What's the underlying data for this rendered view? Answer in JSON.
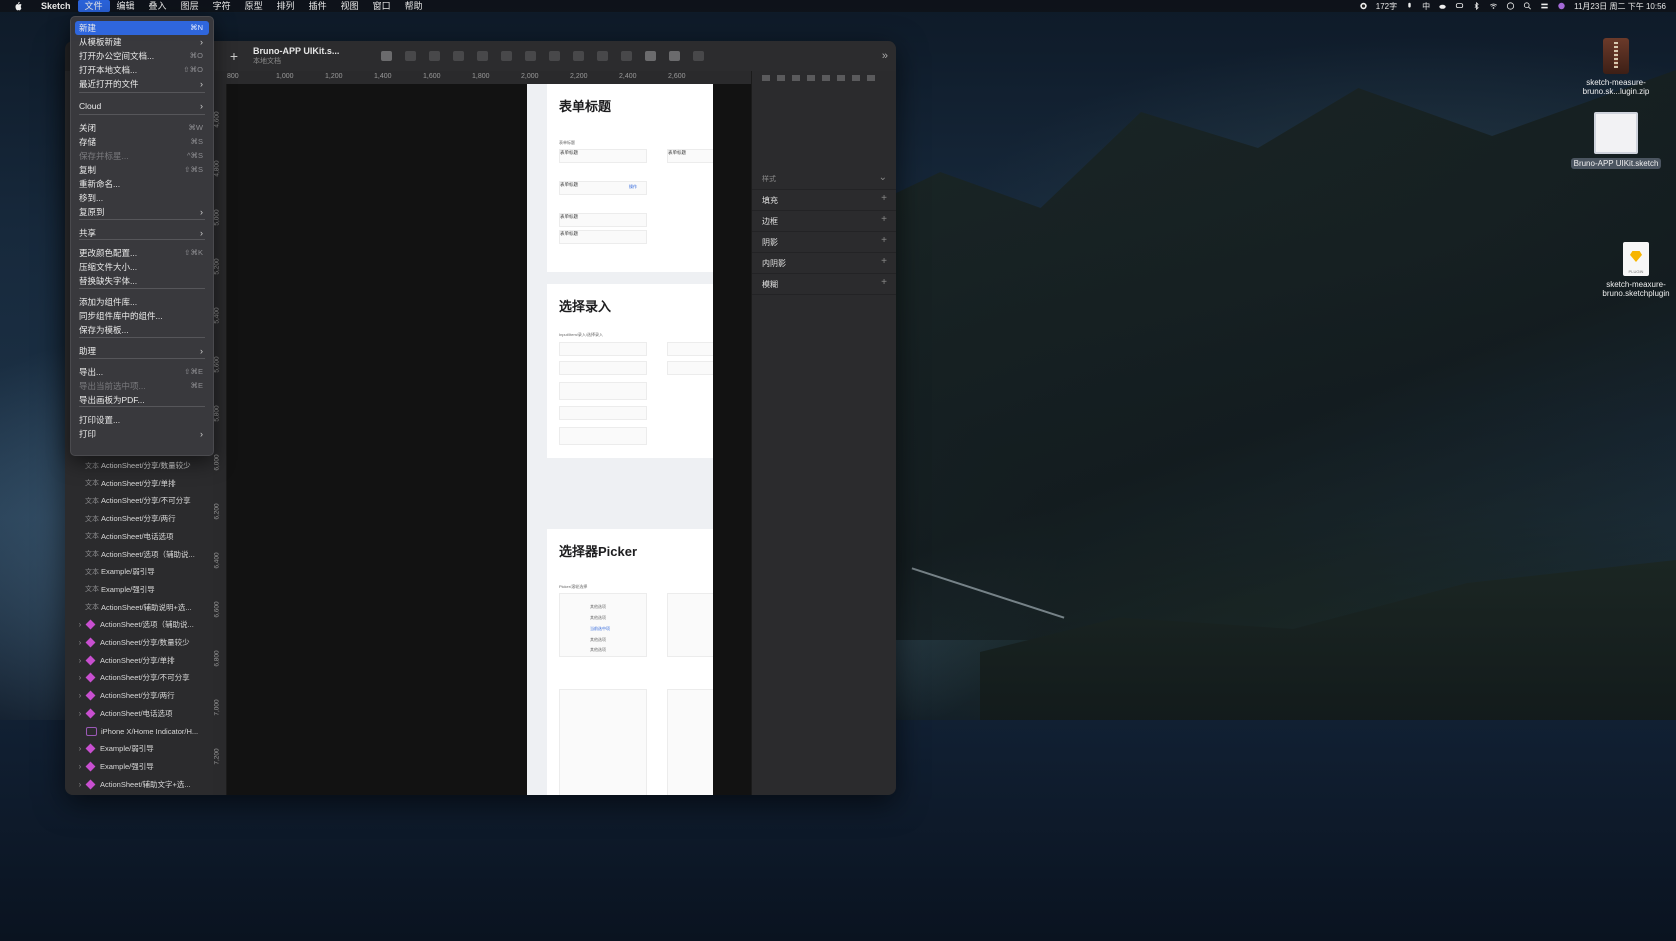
{
  "menubar": {
    "app_name": "Sketch",
    "menus": [
      "文件",
      "编辑",
      "叠入",
      "图层",
      "字符",
      "原型",
      "排列",
      "插件",
      "视图",
      "窗口",
      "帮助"
    ],
    "status_text": "172字",
    "input_method": "中",
    "datetime": "11月23日 周二 下午 10:56"
  },
  "window": {
    "doc_title": "Bruno-APP UIKit.s...",
    "doc_subtitle": "本地文档"
  },
  "ruler": {
    "h_ticks": [
      "800",
      "1,000",
      "1,200",
      "1,400",
      "1,600",
      "1,800",
      "2,000",
      "2,200",
      "2,400",
      "2,600"
    ],
    "v_ticks": [
      "4,600",
      "4,800",
      "5,000",
      "5,200",
      "5,400",
      "5,600",
      "5,800",
      "6,000",
      "6,200",
      "6,400",
      "6,600",
      "6,800",
      "7,000",
      "7,200"
    ]
  },
  "file_menu": {
    "items": [
      {
        "label": "新建",
        "shortcut": "⌘N",
        "selected": true
      },
      {
        "label": "从模板新建",
        "submenu": true
      },
      {
        "label": "打开办公空间文档...",
        "shortcut": "⌘O"
      },
      {
        "label": "打开本地文档...",
        "shortcut": "⇧⌘O"
      },
      {
        "label": "最近打开的文件",
        "submenu": true
      },
      {
        "label": "Cloud",
        "submenu": true
      },
      {
        "label": "关闭",
        "shortcut": "⌘W"
      },
      {
        "label": "存储",
        "shortcut": "⌘S"
      },
      {
        "label": "保存并标星...",
        "shortcut": "^⌘S",
        "disabled": true
      },
      {
        "label": "复制",
        "shortcut": "⇧⌘S"
      },
      {
        "label": "重新命名..."
      },
      {
        "label": "移到..."
      },
      {
        "label": "复原到",
        "submenu": true
      },
      {
        "label": "共享",
        "submenu": true
      },
      {
        "label": "更改颜色配置...",
        "shortcut": "⇧⌘K"
      },
      {
        "label": "压缩文件大小..."
      },
      {
        "label": "替换缺失字体..."
      },
      {
        "label": "添加为组件库..."
      },
      {
        "label": "同步组件库中的组件..."
      },
      {
        "label": "保存为模板..."
      },
      {
        "label": "助理",
        "submenu": true
      },
      {
        "label": "导出...",
        "shortcut": "⇧⌘E"
      },
      {
        "label": "导出当前选中项...",
        "shortcut": "⌘E",
        "disabled": true
      },
      {
        "label": "导出画板为PDF..."
      },
      {
        "label": "打印设置..."
      },
      {
        "label": "打印",
        "submenu": true
      }
    ]
  },
  "layers": [
    {
      "tag": "文本",
      "label": "ActionSheet/分享/数量较少"
    },
    {
      "tag": "文本",
      "label": "ActionSheet/分享/单排"
    },
    {
      "tag": "文本",
      "label": "ActionSheet/分享/不可分享"
    },
    {
      "tag": "文本",
      "label": "ActionSheet/分享/两行"
    },
    {
      "tag": "文本",
      "label": "ActionSheet/电话选项"
    },
    {
      "tag": "文本",
      "label": "ActionSheet/选项（辅助说..."
    },
    {
      "tag": "文本",
      "label": "Example/弱引导"
    },
    {
      "tag": "文本",
      "label": "Example/强引导"
    },
    {
      "tag": "文本",
      "label": "ActionSheet/辅助说明+选..."
    },
    {
      "tag": "sym",
      "label": "ActionSheet/选项（辅助说..."
    },
    {
      "tag": "sym",
      "label": "ActionSheet/分享/数量较少"
    },
    {
      "tag": "sym",
      "label": "ActionSheet/分享/单排"
    },
    {
      "tag": "sym",
      "label": "ActionSheet/分享/不可分享"
    },
    {
      "tag": "sym",
      "label": "ActionSheet/分享/两行"
    },
    {
      "tag": "sym",
      "label": "ActionSheet/电话选项"
    },
    {
      "tag": "ref",
      "label": "iPhone X/Home Indicator/H..."
    },
    {
      "tag": "sym",
      "label": "Example/弱引导"
    },
    {
      "tag": "sym",
      "label": "Example/强引导"
    },
    {
      "tag": "sym",
      "label": "ActionSheet/辅助文字+选..."
    }
  ],
  "artboard": {
    "sections": [
      "表单标题",
      "选择录入",
      "选择器Picker"
    ],
    "form_field": "表单标题",
    "form_action": "操作",
    "select_caption": "Input/Item/录入/选择录入",
    "picker_caption": "Picker/滚轮选择",
    "picker_items": [
      "其他选项",
      "其他选项",
      "当前选中项",
      "其他选项",
      "其他选项"
    ]
  },
  "inspector": {
    "style_label": "样式",
    "rows": [
      "填充",
      "边框",
      "阴影",
      "内阴影",
      "模糊"
    ]
  },
  "desktop_icons": [
    {
      "label": "sketch-measure-bruno.sk...lugin.zip"
    },
    {
      "label": "Bruno-APP UIKit.sketch"
    },
    {
      "label": "sketch-meaxure-bruno.sketchplugin"
    }
  ],
  "colors": {
    "accent": "#2f66dc",
    "symbol": "#c84fd0"
  }
}
